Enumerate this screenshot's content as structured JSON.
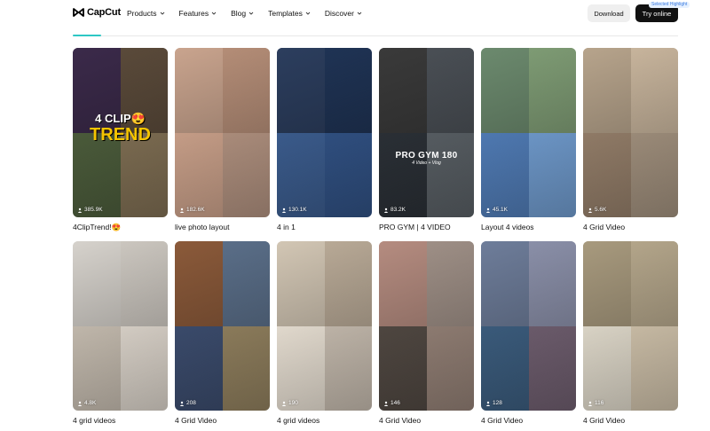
{
  "header": {
    "brand": "CapCut",
    "nav": [
      {
        "label": "Products"
      },
      {
        "label": "Features"
      },
      {
        "label": "Blog"
      },
      {
        "label": "Templates"
      },
      {
        "label": "Discover"
      }
    ],
    "download_label": "Download",
    "try_label": "Try online",
    "try_badge": "Selected Highlight"
  },
  "cards": [
    {
      "title": "4ClipTrend!😍",
      "views": "385.9K",
      "overlay_line1": "4 CLIP😍",
      "overlay_line2": "TREND",
      "colors": [
        "#3b2a4a",
        "#5a4a3a",
        "#4a5a3a",
        "#7a6a50"
      ]
    },
    {
      "title": "live photo layout",
      "views": "182.6K",
      "colors": [
        "#c9a48e",
        "#b48d77",
        "#c49c86",
        "#a98b7a"
      ]
    },
    {
      "title": "4 in 1",
      "views": "130.1K",
      "colors": [
        "#2c3e5e",
        "#1f3354",
        "#3a5a8a",
        "#2f4e7e"
      ]
    },
    {
      "title": "PRO GYM | 4 VIDEO",
      "views": "83.2K",
      "overlay_line1": "PRO GYM 180",
      "overlay_line2": "4 Video + Vlog",
      "colors": [
        "#3a3a3a",
        "#4a4f55",
        "#2a2f35",
        "#555b60"
      ]
    },
    {
      "title": "Layout 4 videos",
      "views": "45.1K",
      "colors": [
        "#6c8a6e",
        "#7e9b74",
        "#4e78b0",
        "#6b94c4"
      ]
    },
    {
      "title": "4 Grid Video",
      "views": "5.6K",
      "colors": [
        "#b7a48c",
        "#c7b49c",
        "#8f7a66",
        "#9a8a78"
      ]
    },
    {
      "title": "4 grid videos",
      "views": "4.8K",
      "colors": [
        "#d6d2cc",
        "#cbc6bf",
        "#bfb6aa",
        "#d2cbc2"
      ]
    },
    {
      "title": "4 Grid Video",
      "views": "208",
      "colors": [
        "#8b5a3a",
        "#5a6e88",
        "#3a4a6a",
        "#8a7a5a"
      ]
    },
    {
      "title": "4 grid videos",
      "views": "190",
      "colors": [
        "#d2c6b4",
        "#b8a996",
        "#e0d8cc",
        "#bcb2a6"
      ]
    },
    {
      "title": "4 Grid Video",
      "views": "146",
      "colors": [
        "#b58c80",
        "#9e8f86",
        "#4e4640",
        "#8c7a70"
      ]
    },
    {
      "title": "4 Grid Video",
      "views": "128",
      "colors": [
        "#6e7d9a",
        "#8a8fa8",
        "#3a5a7a",
        "#6a5a6a"
      ]
    },
    {
      "title": "4 Grid Video",
      "views": "116",
      "colors": [
        "#a89a7e",
        "#b3a58a",
        "#d8d2c4",
        "#c5b8a2"
      ]
    }
  ]
}
